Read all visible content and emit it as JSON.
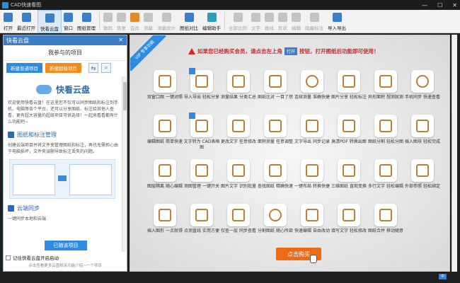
{
  "window": {
    "title": "CAD快速看图",
    "controls": [
      "—",
      "☐",
      "✕"
    ]
  },
  "toolbar": {
    "items": [
      {
        "label": "打开",
        "state": "normal",
        "color": "blue"
      },
      {
        "label": "最近打开",
        "state": "normal",
        "color": "blue"
      },
      {
        "label": "快看云盘",
        "state": "active",
        "color": "blue"
      },
      {
        "label": "窗口",
        "state": "normal",
        "color": "blue"
      },
      {
        "label": "图纸管理",
        "state": "normal",
        "color": "blue"
      },
      {
        "label": "数码",
        "state": "disabled",
        "color": "grey"
      },
      {
        "label": "恢复",
        "state": "disabled",
        "color": "grey"
      },
      {
        "label": "会员",
        "state": "disabled",
        "color": "orange"
      },
      {
        "label": "测量",
        "state": "disabled",
        "color": "grey"
      },
      {
        "label": "测量统计",
        "state": "disabled",
        "color": "grey"
      },
      {
        "label": "图纸对比",
        "state": "normal",
        "color": "blue"
      },
      {
        "label": "编辑助手",
        "state": "normal",
        "color": "teal"
      },
      {
        "label": "全部比例",
        "state": "disabled",
        "color": "grey"
      },
      {
        "label": "文字",
        "state": "disabled",
        "color": "grey"
      },
      {
        "label": "画线",
        "state": "disabled",
        "color": "grey"
      },
      {
        "label": "形状",
        "state": "disabled",
        "color": "grey"
      },
      {
        "label": "编辑",
        "state": "disabled",
        "color": "grey"
      },
      {
        "label": "隐藏标注",
        "state": "disabled",
        "color": "grey"
      },
      {
        "label": "导入导出",
        "state": "normal",
        "color": "blue"
      }
    ]
  },
  "left_panel": {
    "title": "快看云盘",
    "project": "我参与的项目",
    "new_project_btn": "新建普通项目",
    "new_advanced_btn": "新建超级项目",
    "refresh_icon": "⇆",
    "search_icon": "⌕",
    "brand": "快看云盘",
    "intro": "欢迎使用快看云盘！在这里您不仅可以同步图纸和标注到手机、电脑等各个平台，还可以分享图纸、标注给其他人查看，更有超大容量的超级项目可供选择！一起来看看都有什么功能吧~",
    "section1": "图纸和标注管理",
    "section1_text": "创建云端项目并将文件夹管理图纸和标注，再也无需担心由于电脑损坏，文件夹误删导致标注丢失的问题。",
    "section2": "云端同步",
    "section2_text": "一键同步本地和云端",
    "bottom_button": "已随该项目",
    "checkbox_label": "记住快看云盘开启启动",
    "footer": "点击查看更多云盘相关功能介绍~一个项目"
  },
  "main": {
    "vip_ribbon": "VIP 专享功能",
    "notice_pre": "如果您已经购买会员，请点击左上角",
    "notice_tag": "打开",
    "notice_post": "按钮，打开图纸后功能即可使用！",
    "buy_button": "点击购买",
    "features": [
      {
        "label": "双窗口图 一键对照",
        "shape": "square",
        "badge": false
      },
      {
        "label": "导入导出 轻松分享",
        "shape": "square",
        "badge": true
      },
      {
        "label": "测量结果 分类汇总",
        "shape": "square",
        "badge": false
      },
      {
        "label": "图纸比对 一目了然",
        "shape": "square",
        "badge": false
      },
      {
        "label": "连续测量 准确快捷",
        "shape": "circle",
        "badge": false
      },
      {
        "label": "图片分享 轻松标注",
        "shape": "square",
        "badge": false
      },
      {
        "label": "异形面积 想测就测",
        "shape": "square",
        "badge": false
      },
      {
        "label": "手机同步 快速查看",
        "shape": "circle",
        "badge": false
      },
      {
        "label": "编辑图纸 简单快速",
        "shape": "square",
        "badge": false
      },
      {
        "label": "文字转为 CAD表格图",
        "shape": "square",
        "badge": true
      },
      {
        "label": "更改文字 任意修改",
        "shape": "square",
        "badge": false
      },
      {
        "label": "面积测量 任意调整",
        "shape": "square",
        "badge": false
      },
      {
        "label": "文字导出 同步记录",
        "shape": "square",
        "badge": false
      },
      {
        "label": "高清PDF 转换出图",
        "shape": "square",
        "badge": false
      },
      {
        "label": "图纸分割 轻松分图",
        "shape": "square",
        "badge": false
      },
      {
        "label": "插入图块 轻松完成",
        "shape": "square",
        "badge": false
      },
      {
        "label": "图层隔离 随心编辑",
        "shape": "square",
        "badge": false
      },
      {
        "label": "测图管理 一键开关",
        "shape": "square",
        "badge": false
      },
      {
        "label": "图片文字 识别批量",
        "shape": "square",
        "badge": false
      },
      {
        "label": "查找图纸 精确快速",
        "shape": "square",
        "badge": false
      },
      {
        "label": "一键布局 转换快捷",
        "shape": "square",
        "badge": false
      },
      {
        "label": "三维图纸 直观变换",
        "shape": "square",
        "badge": false
      },
      {
        "label": "多行文字 轻松编辑",
        "shape": "square",
        "badge": false
      },
      {
        "label": "外部参照 轻松绑定",
        "shape": "square",
        "badge": false
      },
      {
        "label": "插入图形 一点就得",
        "shape": "square",
        "badge": false
      },
      {
        "label": "点测直线 实用方便",
        "shape": "square",
        "badge": false
      },
      {
        "label": "仅查一层 同步查看",
        "shape": "square",
        "badge": false
      },
      {
        "label": "分割图纸 随心所欲",
        "shape": "circle",
        "badge": false
      },
      {
        "label": "快速编辑 自由改动",
        "shape": "square",
        "badge": false
      },
      {
        "label": "填写文字 轻松修改",
        "shape": "square",
        "badge": false
      },
      {
        "label": "图纸合并 移动随意",
        "shape": "square",
        "badge": false
      }
    ]
  },
  "status": {
    "badge": "中"
  }
}
